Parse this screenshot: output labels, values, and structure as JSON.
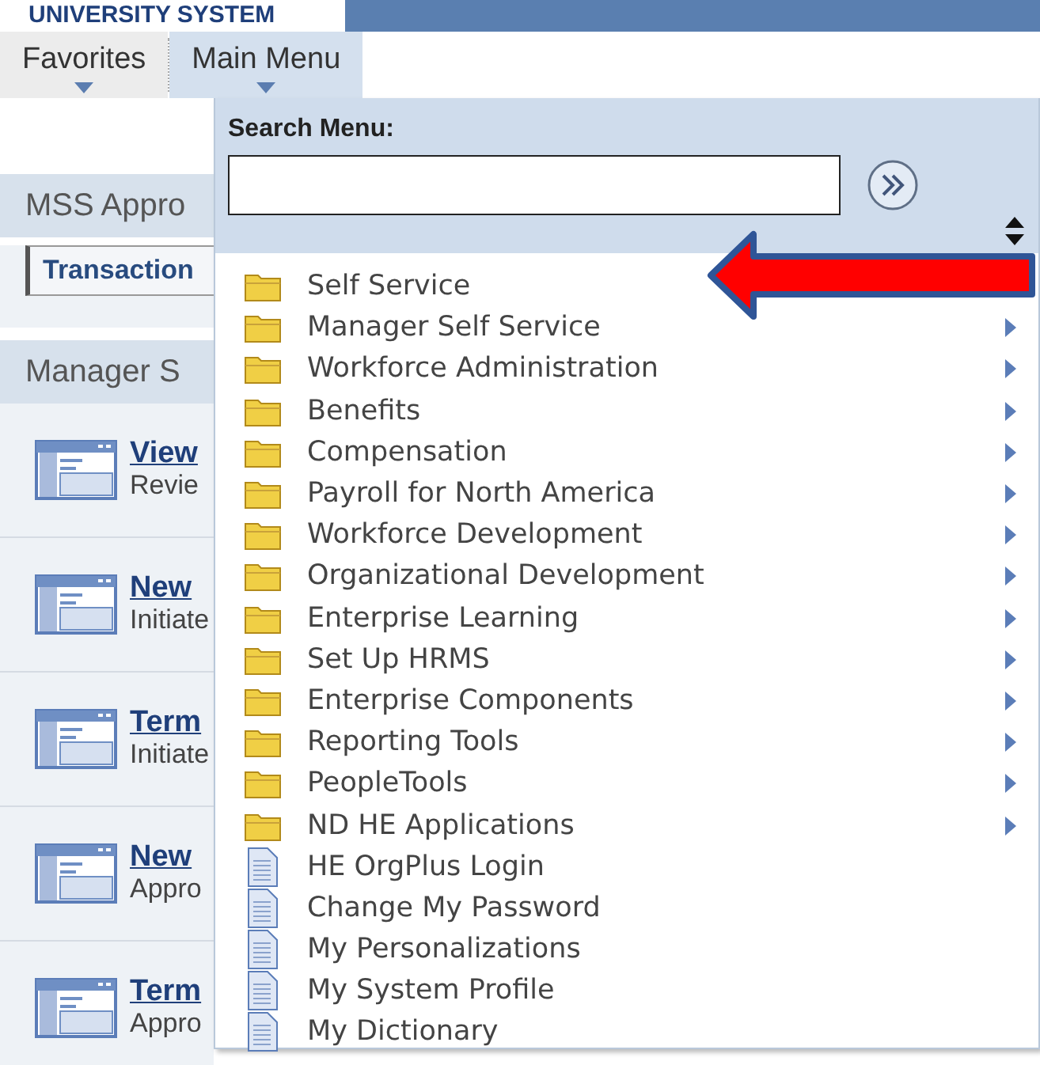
{
  "header": {
    "title": "UNIVERSITY SYSTEM"
  },
  "nav": [
    {
      "label": "Favorites",
      "selected": false
    },
    {
      "label": "Main Menu",
      "selected": true
    }
  ],
  "background_page": {
    "approvals_panel": {
      "title": "MSS Appro",
      "tab": "Transaction"
    },
    "manager_panel": {
      "title": "Manager S",
      "items": [
        {
          "link": "View",
          "description": "Revie"
        },
        {
          "link": "New",
          "description": "Initiate"
        },
        {
          "link": "Term",
          "description": "Initiate"
        },
        {
          "link": "New",
          "description": "Appro"
        },
        {
          "link": "Term",
          "description": "Appro"
        }
      ]
    }
  },
  "main_menu": {
    "search_label": "Search Menu:",
    "items": [
      {
        "label": "Self Service",
        "kind": "folder"
      },
      {
        "label": "Manager Self Service",
        "kind": "folder",
        "has_submenu": true
      },
      {
        "label": "Workforce Administration",
        "kind": "folder",
        "has_submenu": true
      },
      {
        "label": "Benefits",
        "kind": "folder",
        "has_submenu": true
      },
      {
        "label": "Compensation",
        "kind": "folder",
        "has_submenu": true
      },
      {
        "label": "Payroll for North America",
        "kind": "folder",
        "has_submenu": true
      },
      {
        "label": "Workforce Development",
        "kind": "folder",
        "has_submenu": true
      },
      {
        "label": "Organizational Development",
        "kind": "folder",
        "has_submenu": true
      },
      {
        "label": "Enterprise Learning",
        "kind": "folder",
        "has_submenu": true
      },
      {
        "label": "Set Up HRMS",
        "kind": "folder",
        "has_submenu": true
      },
      {
        "label": "Enterprise Components",
        "kind": "folder",
        "has_submenu": true
      },
      {
        "label": "Reporting Tools",
        "kind": "folder",
        "has_submenu": true
      },
      {
        "label": "PeopleTools",
        "kind": "folder",
        "has_submenu": true
      },
      {
        "label": "ND HE Applications",
        "kind": "folder",
        "has_submenu": true
      },
      {
        "label": "HE OrgPlus Login",
        "kind": "page",
        "has_submenu": false
      },
      {
        "label": "Change My Password",
        "kind": "page",
        "has_submenu": false
      },
      {
        "label": "My Personalizations",
        "kind": "page",
        "has_submenu": false
      },
      {
        "label": "My System Profile",
        "kind": "page",
        "has_submenu": false
      },
      {
        "label": "My Dictionary",
        "kind": "page",
        "has_submenu": false
      }
    ]
  }
}
